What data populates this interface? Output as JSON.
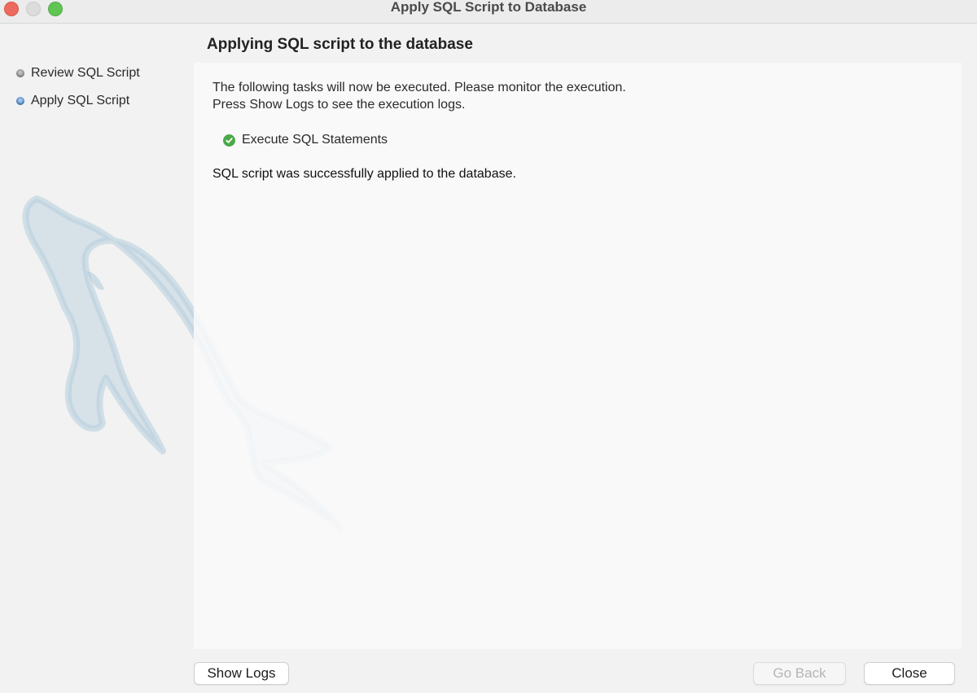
{
  "window": {
    "title": "Apply SQL Script to Database"
  },
  "sidebar": {
    "steps": [
      {
        "label": "Review SQL Script",
        "state": "done"
      },
      {
        "label": "Apply SQL Script",
        "state": "current"
      }
    ]
  },
  "main": {
    "heading": "Applying SQL script to the database",
    "intro_line1": "The following tasks will now be executed. Please monitor the execution.",
    "intro_line2": "Press Show Logs to see the execution logs.",
    "tasks": [
      {
        "label": "Execute SQL Statements",
        "status": "success",
        "icon": "check-circle-icon"
      }
    ],
    "result": "SQL script was successfully applied to the database."
  },
  "footer": {
    "show_logs": "Show Logs",
    "go_back": "Go Back",
    "go_back_enabled": false,
    "close": "Close"
  },
  "colors": {
    "success": "#4ca94a",
    "current_step": "#4c86cc",
    "close_light": "#ed6a5e",
    "maximize_light": "#61c554"
  },
  "watermark_icon": "mysql-dolphin-icon"
}
